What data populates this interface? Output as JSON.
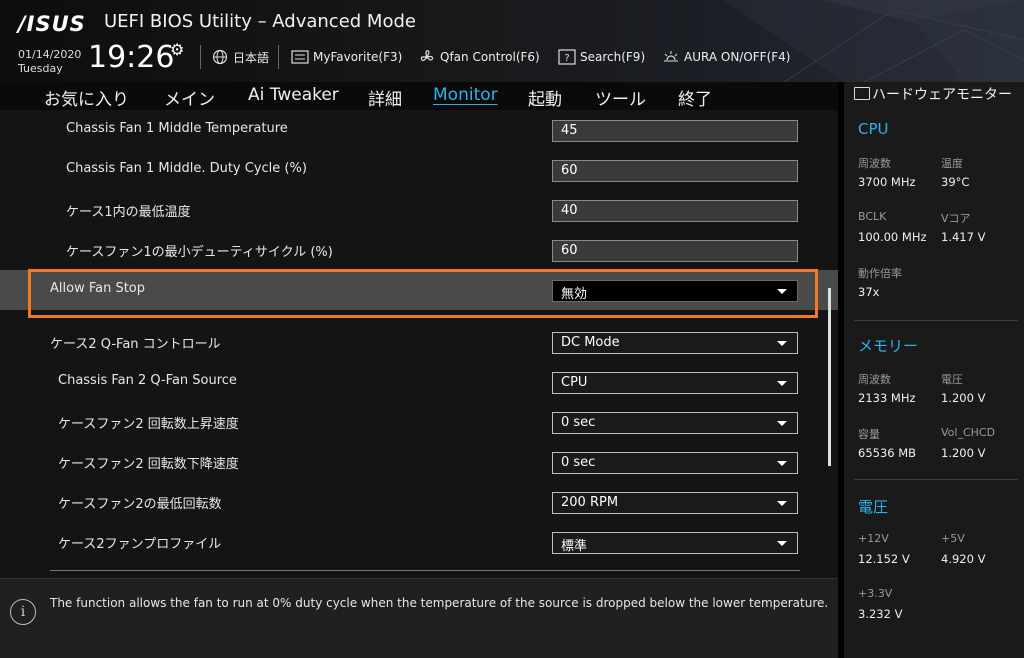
{
  "header": {
    "logo_text": "/ISUS",
    "title": "UEFI BIOS Utility – Advanced Mode",
    "date": "01/14/2020",
    "day": "Tuesday",
    "time": "19:26",
    "buttons": [
      {
        "label": "日本語",
        "icon": "globe-icon"
      },
      {
        "label": "MyFavorite(F3)",
        "icon": "favorite-icon"
      },
      {
        "label": "Qfan Control(F6)",
        "icon": "fan-icon"
      },
      {
        "label": "Search(F9)",
        "icon": "search-icon"
      },
      {
        "label": "AURA ON/OFF(F4)",
        "icon": "aura-icon"
      }
    ]
  },
  "nav": {
    "tabs": [
      "お気に入り",
      "メイン",
      "Ai Tweaker",
      "詳細",
      "Monitor",
      "起動",
      "ツール",
      "終了"
    ],
    "active": "Monitor"
  },
  "settings": [
    {
      "label": "Chassis Fan 1 Middle Temperature",
      "value": "45",
      "type": "input"
    },
    {
      "label": "Chassis Fan 1 Middle. Duty Cycle (%)",
      "value": "60",
      "type": "input"
    },
    {
      "label": "ケース1内の最低温度",
      "value": "40",
      "type": "input"
    },
    {
      "label": "ケースファン1の最小デューティサイクル (%)",
      "value": "60",
      "type": "input"
    },
    {
      "label": "Allow Fan Stop",
      "value": "無効",
      "type": "select"
    },
    {
      "label": "ケース2 Q-Fan コントロール",
      "value": "DC Mode",
      "type": "select"
    },
    {
      "label": "Chassis Fan 2 Q-Fan Source",
      "value": "CPU",
      "type": "select"
    },
    {
      "label": "ケースファン2 回転数上昇速度",
      "value": "0 sec",
      "type": "select"
    },
    {
      "label": "ケースファン2 回転数下降速度",
      "value": "0 sec",
      "type": "select"
    },
    {
      "label": "ケースファン2の最低回転数",
      "value": "200 RPM",
      "type": "select"
    },
    {
      "label": "ケース2ファンプロファイル",
      "value": "標準",
      "type": "select"
    }
  ],
  "help": {
    "text": "The function allows the fan to run at 0% duty cycle when the temperature of the source is dropped below the lower temperature."
  },
  "hwmon": {
    "title": "ハードウェアモニター",
    "cpu": {
      "section": "CPU",
      "freq_k": "周波数",
      "freq_v": "3700 MHz",
      "temp_k": "温度",
      "temp_v": "39°C",
      "bclk_k": "BCLK",
      "bclk_v": "100.00 MHz",
      "vcore_k": "Vコア",
      "vcore_v": "1.417 V",
      "ratio_k": "動作倍率",
      "ratio_v": "37x"
    },
    "memory": {
      "section": "メモリー",
      "freq_k": "周波数",
      "freq_v": "2133 MHz",
      "volt_k": "電圧",
      "volt_v": "1.200 V",
      "cap_k": "容量",
      "cap_v": "65536 MB",
      "vol_chcd_k": "Vol_CHCD",
      "vol_chcd_v": "1.200 V"
    },
    "voltage": {
      "section": "電圧",
      "v12_k": "+12V",
      "v12_v": "12.152 V",
      "v5_k": "+5V",
      "v5_v": "4.920 V",
      "v33_k": "+3.3V",
      "v33_v": "3.232 V"
    }
  }
}
